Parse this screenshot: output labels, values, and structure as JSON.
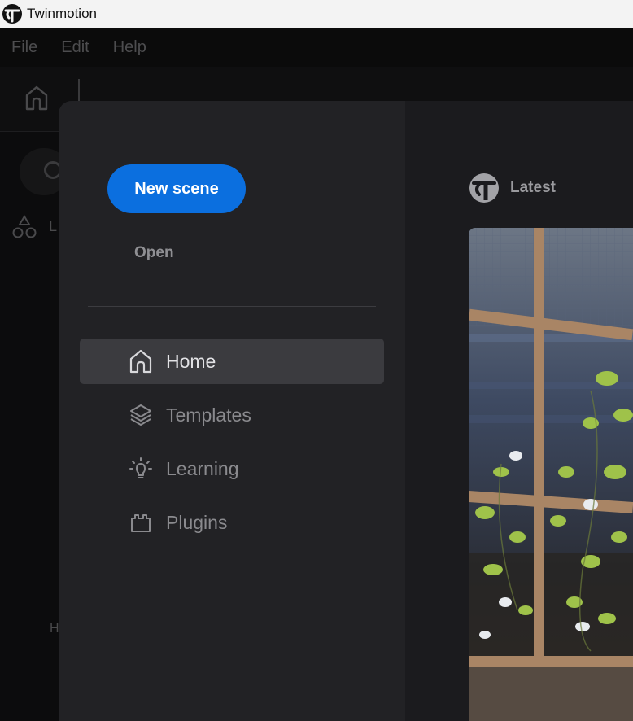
{
  "window": {
    "title": "Twinmotion",
    "logo_icon": "twinmotion-logo-icon"
  },
  "menubar": {
    "items": [
      "File",
      "Edit",
      "Help"
    ]
  },
  "background": {
    "letters": {
      "l": "L",
      "h": "H"
    }
  },
  "sidebar": {
    "new_scene_label": "New scene",
    "open_label": "Open",
    "nav": [
      {
        "label": "Home",
        "icon": "home-icon",
        "active": true
      },
      {
        "label": "Templates",
        "icon": "layers-icon",
        "active": false
      },
      {
        "label": "Learning",
        "icon": "lightbulb-icon",
        "active": false
      },
      {
        "label": "Plugins",
        "icon": "plugin-icon",
        "active": false
      }
    ]
  },
  "content": {
    "section_title": "Latest",
    "section_icon": "twinmotion-logo-icon"
  },
  "colors": {
    "accent": "#0b6fdf",
    "modal_left": "#222225",
    "modal_right": "#1b1b1e",
    "active_nav": "#3b3b3f"
  }
}
